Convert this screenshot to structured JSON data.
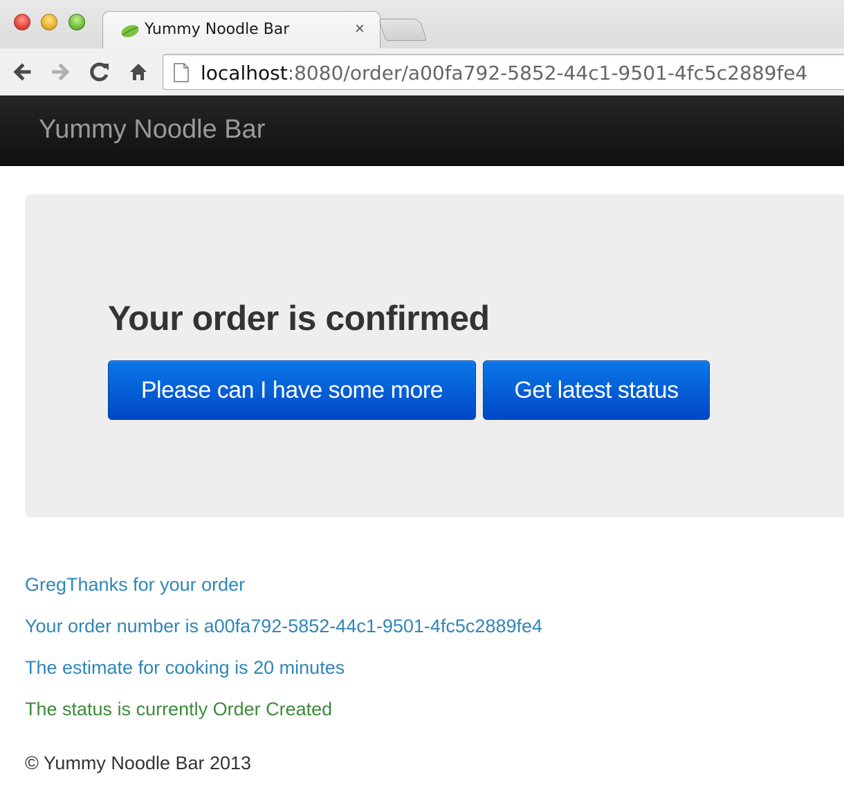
{
  "browser": {
    "tab_title": "Yummy Noodle Bar",
    "tab_close": "×",
    "url_host": "localhost",
    "url_rest": ":8080/order/a00fa792-5852-44c1-9501-4fc5c2889fe4",
    "icons": {
      "back": "back-arrow-icon",
      "forward": "forward-arrow-icon",
      "reload": "reload-icon",
      "home": "home-icon",
      "page": "page-icon",
      "favicon": "spring-leaf-icon"
    }
  },
  "navbar": {
    "brand": "Yummy Noodle Bar"
  },
  "hero": {
    "heading": "Your order is confirmed",
    "more_button": "Please can I have some more",
    "status_button": "Get latest status"
  },
  "order": {
    "thanks": "GregThanks for your order",
    "number_line": "Your order number is a00fa792-5852-44c1-9501-4fc5c2889fe4",
    "estimate_line": "The estimate for cooking is 20 minutes",
    "status_line": "The status is currently Order Created"
  },
  "footer": {
    "copyright": "© Yummy Noodle Bar 2013"
  },
  "colors": {
    "navbar_bg": "#1b1b1b",
    "hero_bg": "#eeeeee",
    "primary_button": "#0061d8",
    "info_text": "#2f86b8",
    "success_text": "#3d8a3b"
  }
}
